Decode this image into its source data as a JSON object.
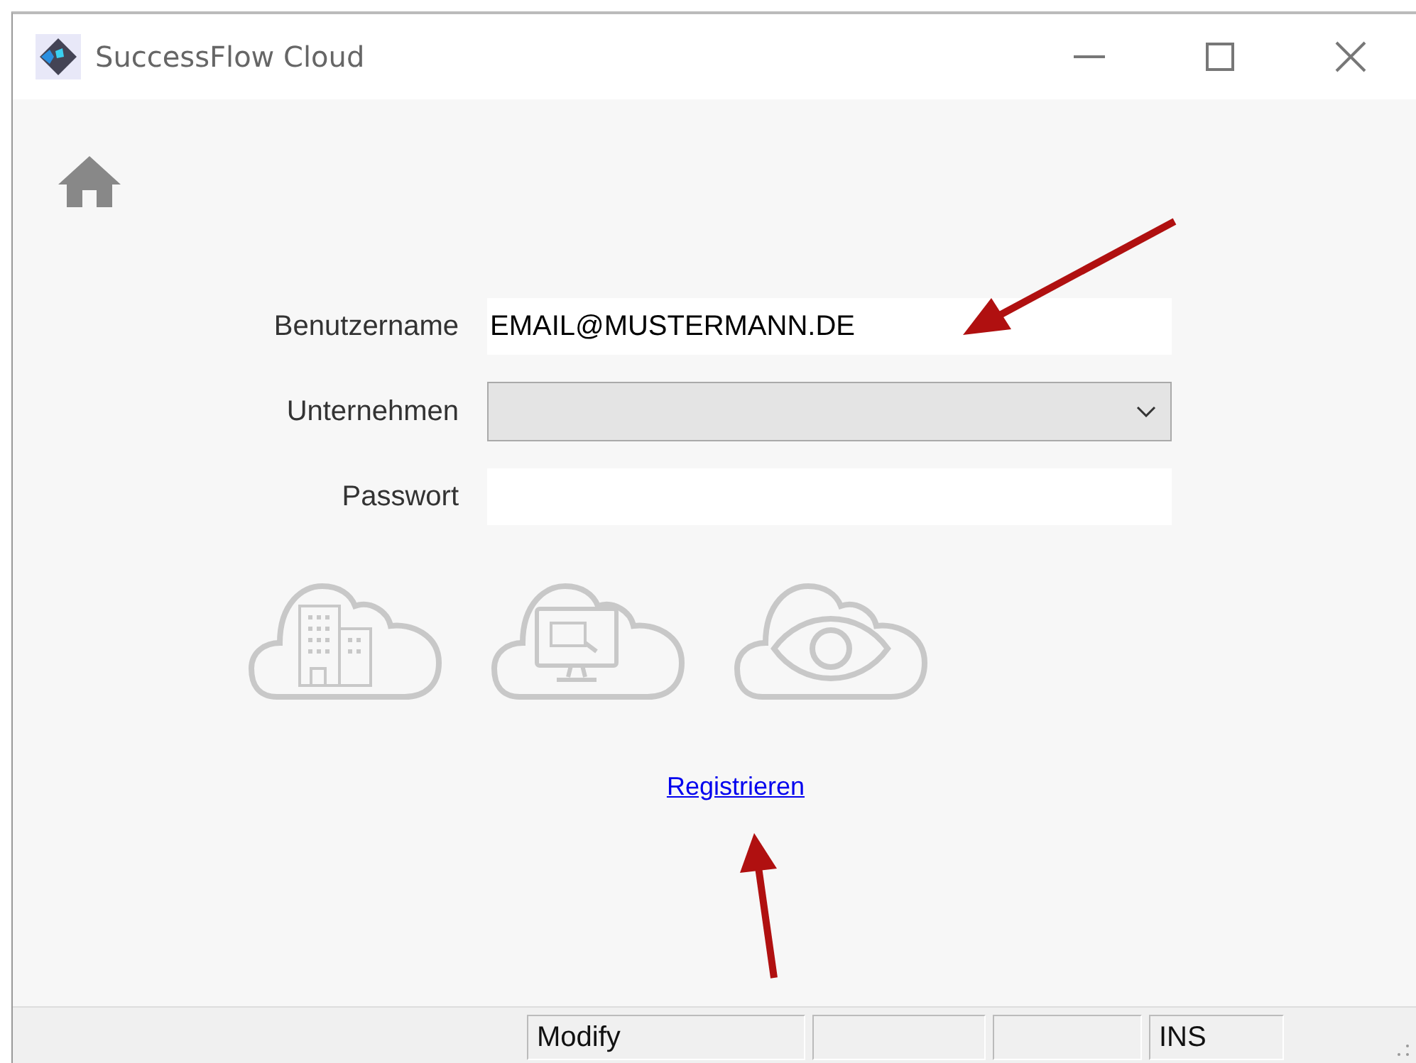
{
  "window": {
    "title": "SuccessFlow Cloud"
  },
  "fields": [
    {
      "label": "Benutzername",
      "kind": "text",
      "value": "EMAIL@MUSTERMANN.DE"
    },
    {
      "label": "Unternehmen",
      "kind": "select"
    },
    {
      "label": "Passwort",
      "kind": "password"
    }
  ],
  "link": "Registrieren",
  "status_bar": [
    {
      "kind": "text",
      "text": "Modify"
    },
    {
      "kind": "empty"
    },
    {
      "kind": "empty"
    },
    {
      "kind": "text",
      "text": "INS"
    }
  ]
}
